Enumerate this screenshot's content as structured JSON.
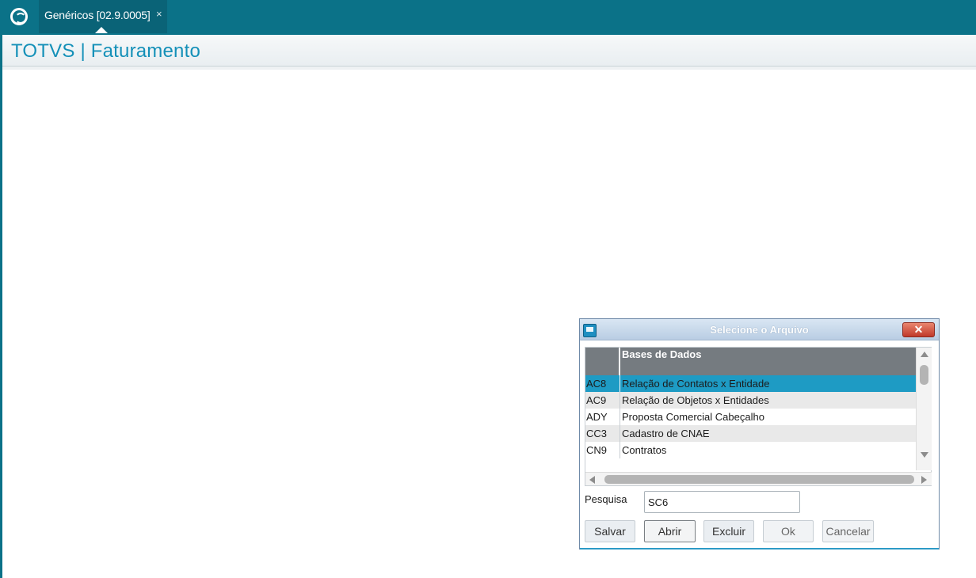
{
  "topbar": {
    "tab_label": "Genéricos [02.9.0005]",
    "tab_close": "×"
  },
  "header": {
    "title": "TOTVS | Faturamento"
  },
  "dialog": {
    "title": "Selecione o Arquivo",
    "close": "✕",
    "grid": {
      "columns": [
        "",
        "Bases de Dados"
      ],
      "rows": [
        {
          "code": "AC8",
          "name": "Relação de Contatos x Entidade",
          "selected": true
        },
        {
          "code": "AC9",
          "name": "Relação de Objetos x Entidades"
        },
        {
          "code": "ADY",
          "name": "Proposta Comercial Cabeçalho"
        },
        {
          "code": "CC3",
          "name": "Cadastro de CNAE"
        },
        {
          "code": "CN9",
          "name": "Contratos"
        }
      ]
    },
    "search": {
      "label": "Pesquisa",
      "value": "SC6"
    },
    "buttons": {
      "save": "Salvar",
      "open": "Abrir",
      "delete": "Excluir",
      "ok": "Ok",
      "cancel": "Cancelar"
    }
  },
  "colors": {
    "topbar": "#0b7288",
    "title": "#1490b8",
    "selected_row": "#1e9bc4"
  }
}
